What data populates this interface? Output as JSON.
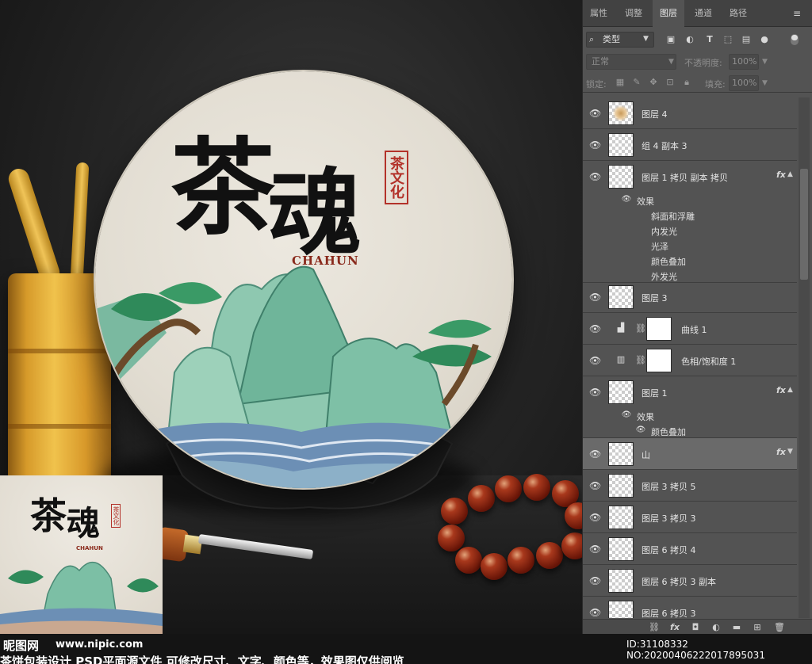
{
  "panel": {
    "tabs": [
      {
        "label": "属性",
        "active": false
      },
      {
        "label": "调整",
        "active": false
      },
      {
        "label": "图层",
        "active": true
      },
      {
        "label": "通道",
        "active": false
      },
      {
        "label": "路径",
        "active": false
      }
    ],
    "filter": {
      "select_value": "类型"
    },
    "blend": {
      "mode": "正常",
      "opacity_label": "不透明度:",
      "opacity_value": "100%"
    },
    "lock": {
      "label": "锁定:",
      "fill_label": "填充:",
      "fill_value": "100%"
    }
  },
  "layers": [
    {
      "name": "图层 4",
      "kind": "pixel",
      "fx": false
    },
    {
      "name": "组 4 副本 3",
      "kind": "pixel",
      "fx": false
    },
    {
      "name": "图层 1 拷贝 副本 拷贝",
      "kind": "pixel",
      "fx": true,
      "effects": [
        "斜面和浮雕",
        "内发光",
        "光泽",
        "颜色叠加",
        "外发光"
      ]
    },
    {
      "name": "图层 3",
      "kind": "pixel",
      "fx": false
    },
    {
      "name": "曲线 1",
      "kind": "adjustment",
      "fx": false
    },
    {
      "name": "色相/饱和度 1",
      "kind": "adjustment",
      "fx": false
    },
    {
      "name": "图层 1",
      "kind": "pixel",
      "fx": true,
      "effects": [
        "颜色叠加"
      ]
    },
    {
      "name": "山",
      "kind": "pixel",
      "fx": true,
      "selected": true
    },
    {
      "name": "图层 3 拷贝 5",
      "kind": "pixel",
      "fx": false
    },
    {
      "name": "图层 3 拷贝 3",
      "kind": "pixel",
      "fx": false
    },
    {
      "name": "图层 6 拷贝 4",
      "kind": "pixel",
      "fx": false
    },
    {
      "name": "图层 6 拷贝 3 副本",
      "kind": "pixel",
      "fx": false
    },
    {
      "name": "图层 6 拷贝 3",
      "kind": "pixel",
      "fx": false
    }
  ],
  "effects_label": "效果",
  "fx_label": "fx",
  "artwork": {
    "title_chars": [
      "茶",
      "魂"
    ],
    "subtitle": "CHAHUN",
    "seal_text": "茶文化"
  },
  "watermark": {
    "logo": "昵图网",
    "url": "www.nipic.com",
    "id": "ID:31108332 NO:20200406222017895031",
    "caption": "茶饼包装设计 PSD平面源文件 可修改尺寸、文字、颜色等，效果图仅供阅览"
  },
  "colors": {
    "seal_red": "#b3322a",
    "panel_bg": "#535353",
    "mountain_green": "#6fb59a",
    "pine_green": "#2f8a5a"
  }
}
